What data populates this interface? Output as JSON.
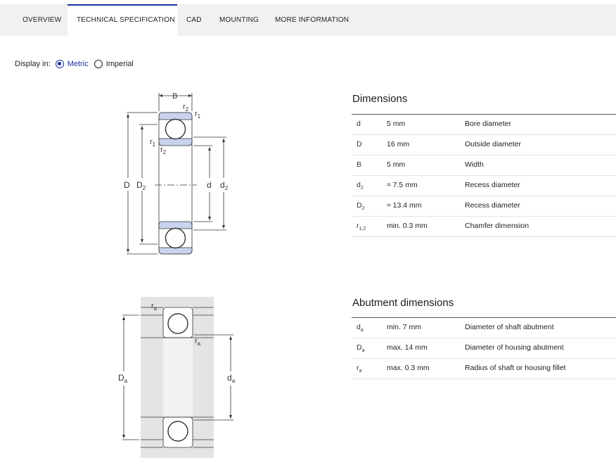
{
  "tabs": [
    {
      "label": "OVERVIEW",
      "active": false
    },
    {
      "label": "TECHNICAL SPECIFICATION",
      "active": true
    },
    {
      "label": "CAD",
      "active": false
    },
    {
      "label": "MOUNTING",
      "active": false
    },
    {
      "label": "MORE INFORMATION",
      "active": false
    }
  ],
  "display": {
    "label": "Display in:",
    "options": [
      {
        "label": "Metric",
        "selected": true
      },
      {
        "label": "Imperial",
        "selected": false
      }
    ]
  },
  "drawing_labels": {
    "B": "B",
    "r": "r",
    "D": "D",
    "d": "d",
    "sub1": "1",
    "sub2": "2",
    "suba": "a"
  },
  "dimensions": {
    "title": "Dimensions",
    "rows": [
      {
        "symbol": "d",
        "sub": "",
        "value": "5 mm",
        "description": "Bore diameter"
      },
      {
        "symbol": "D",
        "sub": "",
        "value": "16 mm",
        "description": "Outside diameter"
      },
      {
        "symbol": "B",
        "sub": "",
        "value": "5 mm",
        "description": "Width"
      },
      {
        "symbol": "d",
        "sub": "2",
        "value": "≈ 7.5 mm",
        "description": "Recess diameter"
      },
      {
        "symbol": "D",
        "sub": "2",
        "value": "≈ 13.4 mm",
        "description": "Recess diameter"
      },
      {
        "symbol": "r",
        "sub": "1,2",
        "value": "min. 0.3 mm",
        "description": "Chamfer dimension"
      }
    ]
  },
  "abutment": {
    "title": "Abutment dimensions",
    "rows": [
      {
        "symbol": "d",
        "sub": "a",
        "value": "min. 7 mm",
        "description": "Diameter of shaft abutment"
      },
      {
        "symbol": "D",
        "sub": "a",
        "value": "max. 14 mm",
        "description": "Diameter of housing abutment"
      },
      {
        "symbol": "r",
        "sub": "a",
        "value": "max. 0.3 mm",
        "description": "Radius of shaft or housing fillet"
      }
    ]
  }
}
